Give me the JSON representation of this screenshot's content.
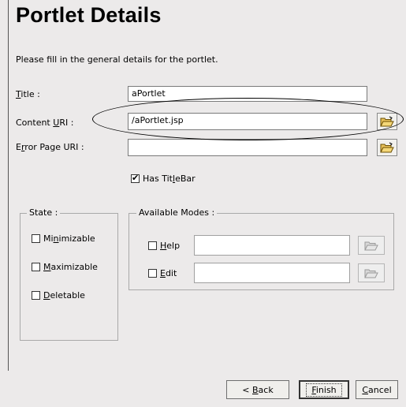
{
  "page_title": "Portlet Details",
  "description": "Please fill in the general details for the portlet.",
  "fields": {
    "title": {
      "label_pre": "",
      "label_u": "T",
      "label_post": "itle :",
      "value": "aPortlet"
    },
    "content_uri": {
      "label_pre": "Content ",
      "label_u": "U",
      "label_post": "RI :",
      "value": "/aPortlet.jsp"
    },
    "error_uri": {
      "label_pre": "E",
      "label_u": "r",
      "label_post": "ror Page URI :",
      "value": ""
    }
  },
  "has_titlebar": {
    "label_pre": "Has Tit",
    "label_u": "l",
    "label_post": "eBar",
    "checked": true
  },
  "state": {
    "title": "State :",
    "items": [
      {
        "pre": "Mi",
        "u": "n",
        "post": "imizable",
        "checked": false
      },
      {
        "pre": "",
        "u": "M",
        "post": "aximizable",
        "checked": false
      },
      {
        "pre": "",
        "u": "D",
        "post": "eletable",
        "checked": false
      }
    ]
  },
  "modes": {
    "title": "Available Modes :",
    "items": [
      {
        "pre": "",
        "u": "H",
        "post": "elp",
        "checked": false,
        "value": ""
      },
      {
        "pre": "",
        "u": "E",
        "post": "dit",
        "checked": false,
        "value": ""
      }
    ]
  },
  "buttons": {
    "back": {
      "pre": "< ",
      "u": "B",
      "post": "ack"
    },
    "finish": {
      "pre": "",
      "u": "F",
      "post": "inish"
    },
    "cancel": {
      "pre": "",
      "u": "C",
      "post": "ancel"
    }
  },
  "icons": {
    "browse": "folder-open-icon"
  }
}
